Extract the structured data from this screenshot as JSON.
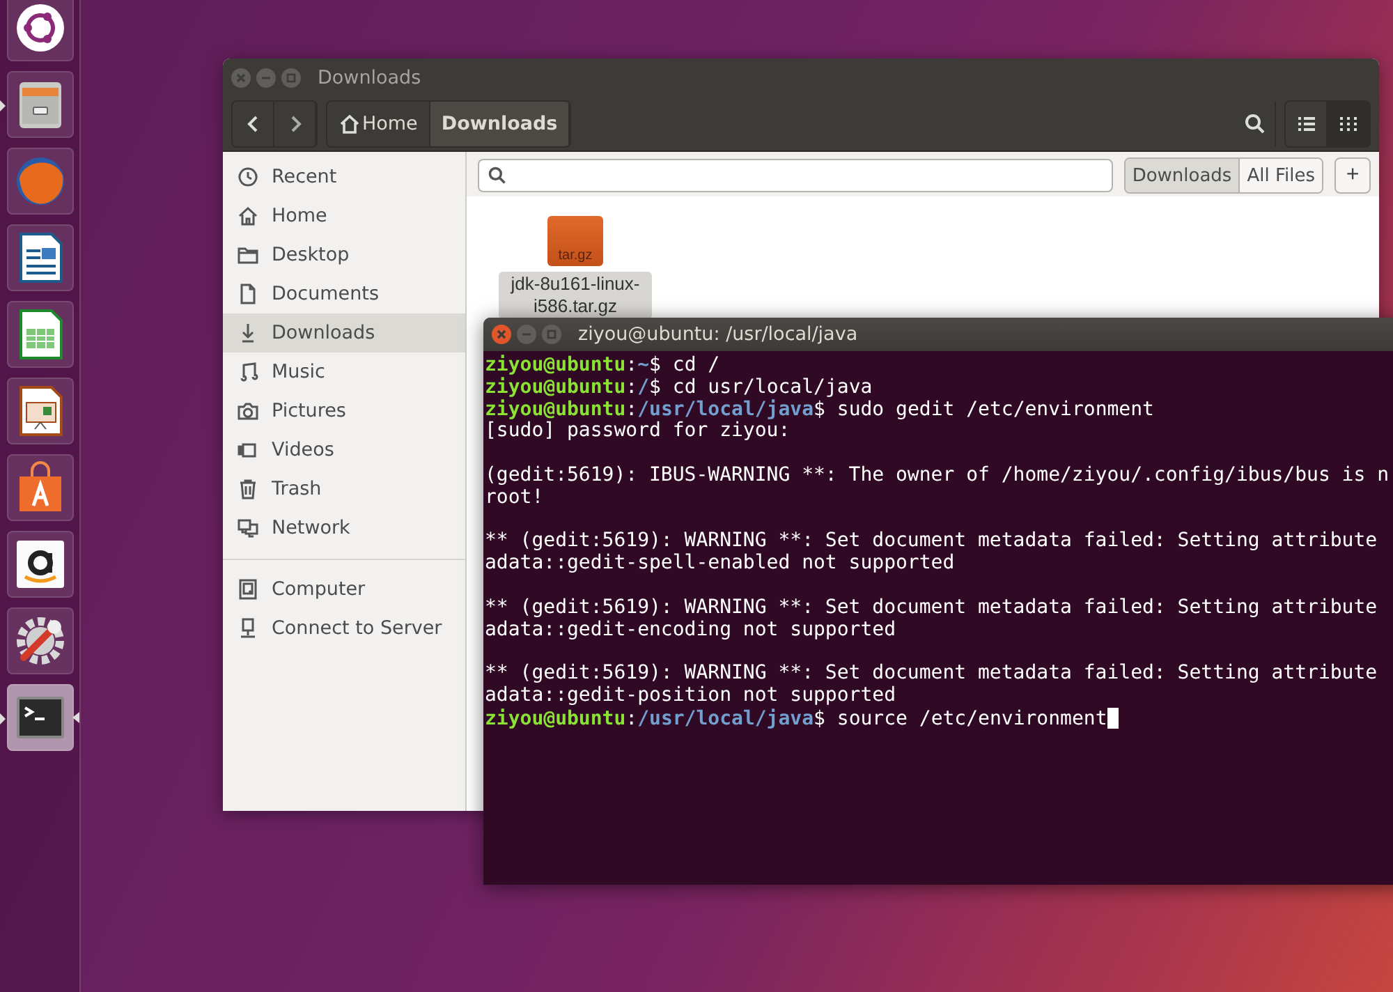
{
  "launcher": {
    "items": [
      {
        "kind": "dash",
        "running": false,
        "focused": false
      },
      {
        "kind": "files",
        "running": true,
        "focused": false
      },
      {
        "kind": "firefox",
        "running": false,
        "focused": false
      },
      {
        "kind": "writer",
        "running": false,
        "focused": false
      },
      {
        "kind": "calc",
        "running": false,
        "focused": false
      },
      {
        "kind": "impress",
        "running": false,
        "focused": false
      },
      {
        "kind": "software",
        "running": false,
        "focused": false
      },
      {
        "kind": "amazon",
        "running": false,
        "focused": false
      },
      {
        "kind": "settings",
        "running": false,
        "focused": false
      },
      {
        "kind": "terminal",
        "running": true,
        "focused": true
      }
    ]
  },
  "files_window": {
    "title": "Downloads",
    "active": false,
    "path": [
      {
        "label": "Home",
        "selected": false
      },
      {
        "label": "Downloads",
        "selected": true
      }
    ],
    "view_buttons": [
      {
        "kind": "list",
        "selected": false
      },
      {
        "kind": "grid",
        "selected": true
      }
    ],
    "sidebar": {
      "places": [
        {
          "label": "Recent",
          "selected": false
        },
        {
          "label": "Home",
          "selected": false
        },
        {
          "label": "Desktop",
          "selected": false
        },
        {
          "label": "Documents",
          "selected": false
        },
        {
          "label": "Downloads",
          "selected": true
        },
        {
          "label": "Music",
          "selected": false
        },
        {
          "label": "Pictures",
          "selected": false
        },
        {
          "label": "Videos",
          "selected": false
        },
        {
          "label": "Trash",
          "selected": false
        },
        {
          "label": "Network",
          "selected": false
        }
      ],
      "devices": [
        {
          "label": "Computer",
          "selected": false
        },
        {
          "label": "Connect to Server",
          "selected": false
        }
      ]
    },
    "scope": [
      {
        "label": "Downloads",
        "selected": true
      },
      {
        "label": "All Files",
        "selected": false
      }
    ],
    "add_label": "+",
    "files": [
      {
        "label": "jdk-8u161-linux-i586.tar.gz",
        "badge": "tar.gz",
        "selected": true
      }
    ]
  },
  "terminal": {
    "title": "ziyou@ubuntu: /usr/local/java",
    "active": true,
    "lines": [
      {
        "kind": "prompt",
        "user": "ziyou@ubuntu",
        "sep": ":",
        "path": "~",
        "rest": "$ cd /",
        "cursor": false
      },
      {
        "kind": "prompt",
        "user": "ziyou@ubuntu",
        "sep": ":",
        "path": "/",
        "rest": "$ cd usr/local/java",
        "cursor": false
      },
      {
        "kind": "prompt",
        "user": "ziyou@ubuntu",
        "sep": ":",
        "path": "/usr/local/java",
        "rest": "$ sudo gedit /etc/environment",
        "cursor": false
      },
      {
        "kind": "output",
        "text": "[sudo] password for ziyou:"
      },
      {
        "kind": "blank"
      },
      {
        "kind": "output",
        "text": "(gedit:5619): IBUS-WARNING **: The owner of /home/ziyou/.config/ibus/bus is n"
      },
      {
        "kind": "output",
        "text": "root!"
      },
      {
        "kind": "blank"
      },
      {
        "kind": "output",
        "text": "** (gedit:5619): WARNING **: Set document metadata failed: Setting attribute"
      },
      {
        "kind": "output",
        "text": "adata::gedit-spell-enabled not supported"
      },
      {
        "kind": "blank"
      },
      {
        "kind": "output",
        "text": "** (gedit:5619): WARNING **: Set document metadata failed: Setting attribute"
      },
      {
        "kind": "output",
        "text": "adata::gedit-encoding not supported"
      },
      {
        "kind": "blank"
      },
      {
        "kind": "output",
        "text": "** (gedit:5619): WARNING **: Set document metadata failed: Setting attribute"
      },
      {
        "kind": "output",
        "text": "adata::gedit-position not supported"
      },
      {
        "kind": "prompt",
        "user": "ziyou@ubuntu",
        "sep": ":",
        "path": "/usr/local/java",
        "rest": "$ source /etc/environment",
        "cursor": true
      }
    ]
  }
}
